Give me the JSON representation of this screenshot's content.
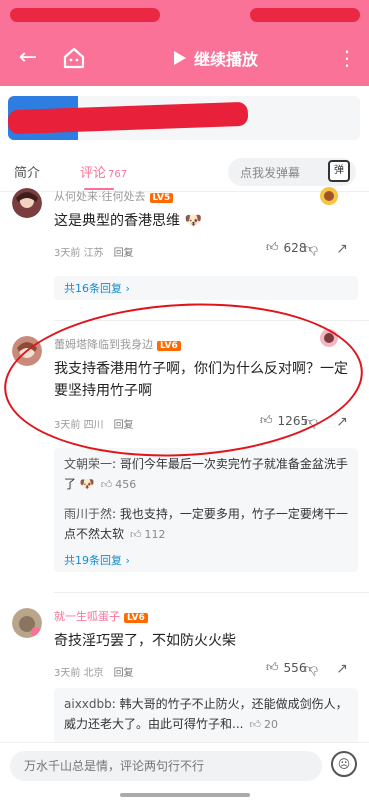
{
  "topbar": {
    "play_label": "继续播放"
  },
  "tabs": [
    {
      "label": "简介"
    },
    {
      "label": "评论",
      "count": "767"
    }
  ],
  "danmaku": {
    "placeholder": "点我发弹幕",
    "icon_label": "弹"
  },
  "comments": [
    {
      "user": "从何处来·往何处去",
      "level": "LV5",
      "text": "这是典型的香港思维 🐶",
      "meta_time": "3天前",
      "meta_location": "江苏",
      "reply_label": "回复",
      "likes": "628",
      "more_replies": "共16条回复 ›",
      "deco_text": "001887"
    },
    {
      "user": "蕾姆塔降临到我身边",
      "level": "LV6",
      "text": "我支持香港用竹子啊，你们为什么反对啊？一定要坚持用竹子啊",
      "meta_time": "3天前",
      "meta_location": "四川",
      "reply_label": "回复",
      "likes": "1265",
      "deco_text": "101877",
      "replies": [
        {
          "name": "文朝荣一",
          "text": "哥们今年最后一次卖完竹子就准备金盆洗手了 🐶",
          "likes": "456"
        },
        {
          "name": "雨川于然",
          "text": "我也支持，一定要多用，竹子一定要烤干一点不然太软",
          "likes": "112"
        }
      ],
      "more_replies": "共19条回复 ›"
    },
    {
      "user": "就一生呱蛋子",
      "level": "LV6",
      "text": "奇技淫巧罢了，不如防火火柴",
      "meta_time": "3天前",
      "meta_location": "北京",
      "reply_label": "回复",
      "likes": "556",
      "replies": [
        {
          "name": "aixxdbb",
          "text": "韩大哥的竹子不止防火，还能做成剑伤人，威力还老大了。由此可得竹子和...",
          "likes": "20"
        }
      ]
    }
  ],
  "bottom": {
    "input_placeholder": "万水千山总是情，评论两句行不行"
  },
  "colors": {
    "brand_pink": "#fb7299",
    "annotation_red": "#e0141a",
    "link_blue": "#178bcf"
  }
}
